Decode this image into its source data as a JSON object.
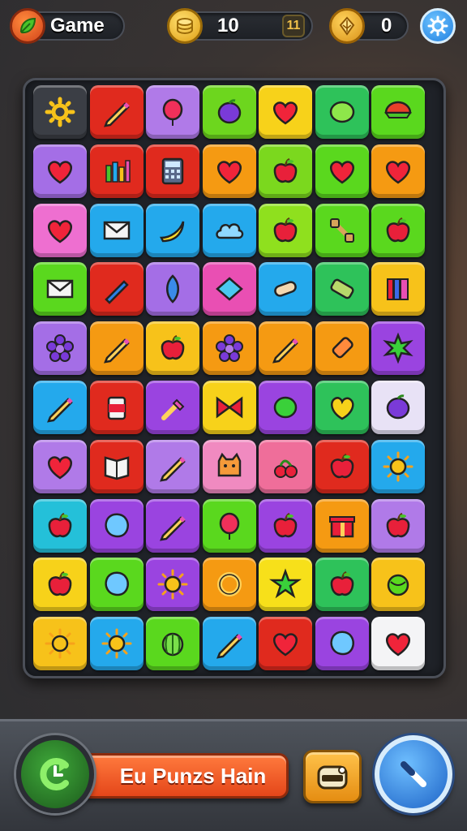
{
  "header": {
    "title": "Game",
    "coins": "10",
    "coin_badge": "11",
    "gems": "0",
    "logo_icon": "leaf-gear-icon",
    "coin_icon": "coin-stack-icon",
    "gem_icon": "gold-leaf-icon",
    "settings_icon": "gear-icon"
  },
  "board": {
    "rows": 10,
    "cols": 7,
    "tiles": [
      [
        "gear",
        "pencil",
        "balloon",
        "plum",
        "heart",
        "lime",
        "half-melon"
      ],
      [
        "heart",
        "bar-chart",
        "calculator",
        "heart",
        "apple",
        "heart",
        "heart"
      ],
      [
        "heart",
        "envelope",
        "banana",
        "cloud",
        "apple",
        "dumbbell",
        "apple"
      ],
      [
        "envelope",
        "pen",
        "leaf",
        "diamond",
        "bandage",
        "scroll",
        "books"
      ],
      [
        "flower",
        "pencil",
        "apple",
        "flower",
        "pencil",
        "crayon",
        "star-leaf"
      ],
      [
        "pencil",
        "can",
        "brush",
        "bow",
        "ball",
        "lemon",
        "plum"
      ],
      [
        "heart",
        "book",
        "pencil",
        "cat",
        "cherry",
        "apple",
        "sun"
      ],
      [
        "apple",
        "blob",
        "pencil",
        "balloon",
        "apple",
        "gift",
        "apple"
      ],
      [
        "apple",
        "blob",
        "sun",
        "ring",
        "star",
        "apple",
        "cabbage"
      ],
      [
        "sun",
        "sun",
        "melon",
        "pencil",
        "heart",
        "blob",
        "heart"
      ]
    ],
    "tile_colors": [
      [
        "#3b3e45",
        "#e02a1e",
        "#b07ae8",
        "#6dd61e",
        "#f7d21a",
        "#2ec25a",
        "#5ad81e"
      ],
      [
        "#a46ee6",
        "#e02a1e",
        "#e02a1e",
        "#f59a12",
        "#7bd81e",
        "#5ad81e",
        "#f59a12"
      ],
      [
        "#ee6fd0",
        "#24a9ec",
        "#24a9ec",
        "#24a9ec",
        "#8fe01e",
        "#5ad81e",
        "#5ad81e"
      ],
      [
        "#5ad81e",
        "#e02a1e",
        "#a46ee6",
        "#e94fb3",
        "#24a9ec",
        "#2ec25a",
        "#f7c21a"
      ],
      [
        "#a46ee6",
        "#f59a12",
        "#f7c21a",
        "#f59a12",
        "#f59a12",
        "#f59a12",
        "#9a44e0"
      ],
      [
        "#24a9ec",
        "#e02a1e",
        "#9a44e0",
        "#f7d21a",
        "#9a44e0",
        "#2ec25a",
        "#e8e2f6"
      ],
      [
        "#b07ae8",
        "#e02a1e",
        "#b07ae8",
        "#f08ac0",
        "#ef6e9a",
        "#e02a1e",
        "#24a9ec"
      ],
      [
        "#24c0d9",
        "#9a44e0",
        "#9a44e0",
        "#5ad81e",
        "#9a44e0",
        "#f59a12",
        "#b07ae8"
      ],
      [
        "#f7d21a",
        "#5ad81e",
        "#9a44e0",
        "#f59a12",
        "#f7e01a",
        "#2ec25a",
        "#f7c21a"
      ],
      [
        "#f7c21a",
        "#24a9ec",
        "#5ad81e",
        "#24a9ec",
        "#e02a1e",
        "#9a44e0",
        "#f4f4f6"
      ]
    ]
  },
  "footer": {
    "main_label": "Eu Punzs Hain",
    "undo_icon": "undo-arrow-icon",
    "booster_icon": "toaster-icon",
    "hint_icon": "wand-icon"
  }
}
